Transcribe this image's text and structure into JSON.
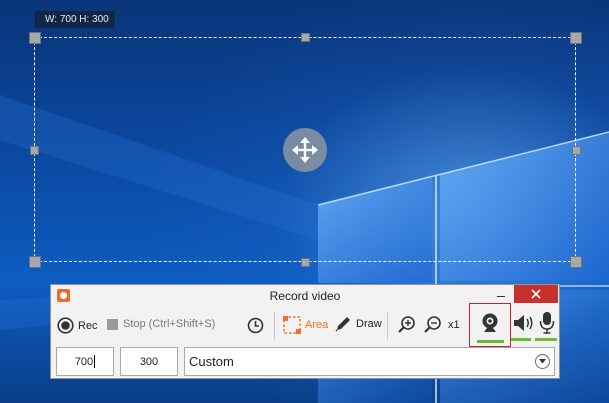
{
  "selection": {
    "size_label": "W: 700 H: 300"
  },
  "window": {
    "title": "Record video"
  },
  "toolbar": {
    "rec_label": "Rec",
    "stop_label": "Stop (Ctrl+Shift+S)",
    "area_label": "Area",
    "draw_label": "Draw",
    "zoom_level": "x1"
  },
  "fields": {
    "width_value": "700",
    "height_value": "300",
    "preset_value": "Custom"
  },
  "colors": {
    "accent_orange": "#ef6b2c",
    "close_red": "#c7312b",
    "level_green": "#6fbb2f",
    "highlight_red": "#c6252b"
  },
  "icons": [
    "windows-logo",
    "move-icon",
    "record-icon",
    "stop-icon",
    "timer-icon",
    "area-icon",
    "pencil-icon",
    "zoom-in-icon",
    "zoom-out-icon",
    "webcam-icon",
    "speaker-icon",
    "microphone-icon",
    "chevron-down-icon",
    "close-icon"
  ]
}
